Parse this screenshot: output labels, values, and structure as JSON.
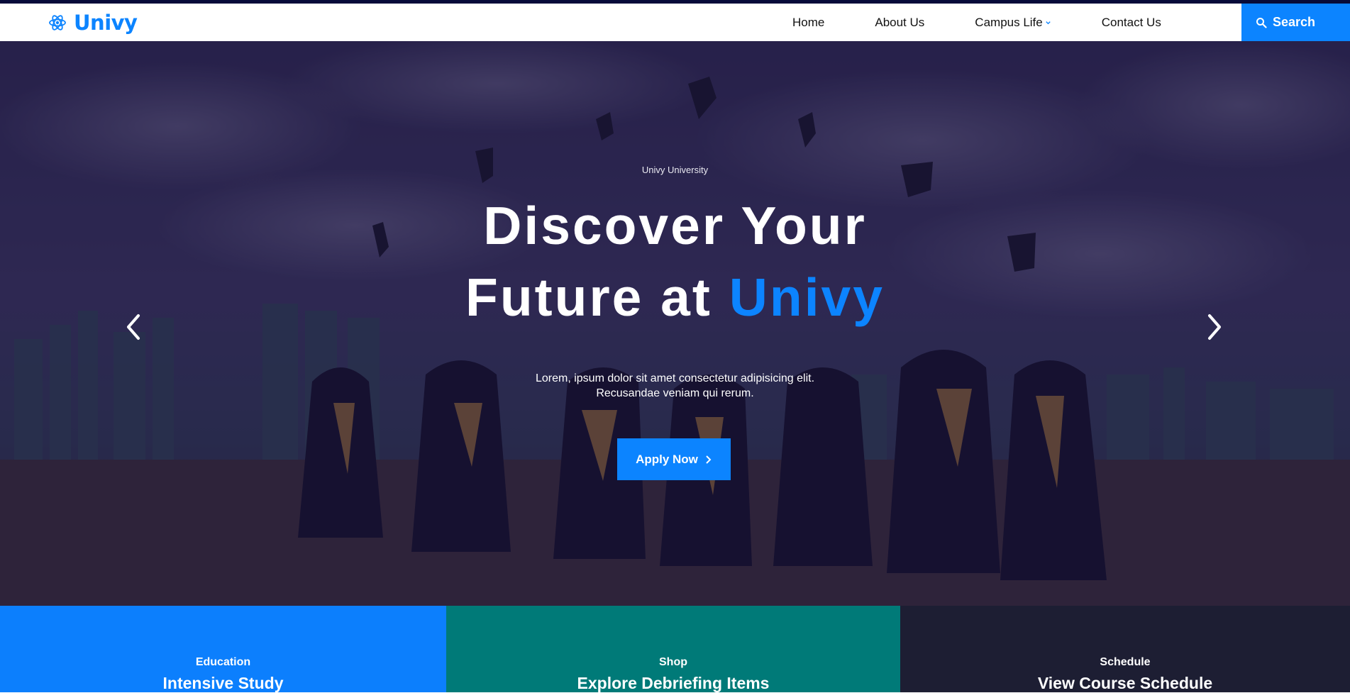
{
  "colors": {
    "accent": "#0c84ff",
    "nav_stripe": "#070b3a",
    "teal": "#007a78",
    "dark": "#1d1e33"
  },
  "brand": {
    "name": "Univy",
    "icon": "atom-icon"
  },
  "nav": {
    "items": [
      {
        "label": "Home"
      },
      {
        "label": "About Us"
      },
      {
        "label": "Campus Life"
      },
      {
        "label": "Contact Us"
      }
    ],
    "search_label": "Search"
  },
  "hero": {
    "eyebrow": "Univy University",
    "headline_line1": "Discover Your",
    "headline_line2_prefix": "Future at",
    "headline_line2_accent": "Univy",
    "lede": "Lorem, ipsum dolor sit amet consectetur adipisicing elit. Recusandae veniam qui rerum.",
    "cta_label": "Apply Now",
    "prev_icon": "chevron-left-icon",
    "next_icon": "chevron-right-icon"
  },
  "features": [
    {
      "label": "Education",
      "title": "Intensive Study"
    },
    {
      "label": "Shop",
      "title": "Explore Debriefing Items"
    },
    {
      "label": "Schedule",
      "title": "View Course Schedule"
    }
  ]
}
